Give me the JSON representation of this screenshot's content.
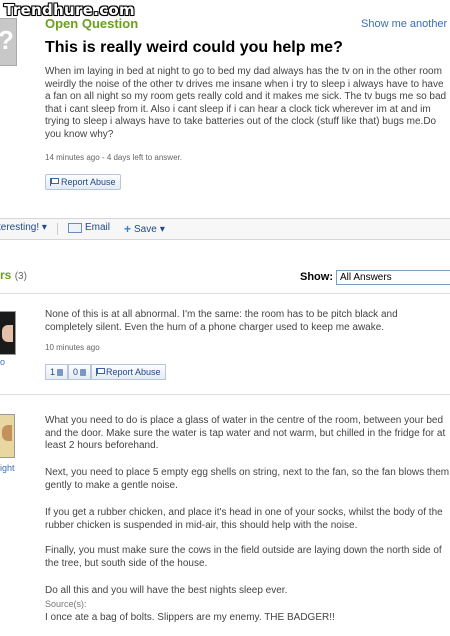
{
  "watermark": "Trendhure.com",
  "question": {
    "header": "Open Question",
    "show_another": "Show me another »",
    "title": "This is really weird could you help me?",
    "body": "When im laying in bed at night to go to bed my dad always has the tv on in the other room weirdly the noise of the other tv drives me insane when i try to sleep i always have to have a fan on all night so my room gets really cold and it makes me sick. The tv bugs me so bad that i cant sleep from it. Also i cant sleep if i can hear a clock tick wherever im at and im trying to sleep i always have to take batteries out of the clock (stuff like that) bugs me.Do you know why?",
    "meta": "14 minutes ago - 4 days left to answer.",
    "report_label": "Report Abuse"
  },
  "actions": {
    "interesting": "teresting!",
    "email": "Email",
    "save": "Save"
  },
  "answers_section": {
    "title": "rs",
    "count": "(3)",
    "show_label": "Show:",
    "show_value": "All Answers"
  },
  "answers": [
    {
      "name_fragment": "o",
      "body": "None of this is at all abnormal. I'm the same: the room has to be pitch black and completely silent. Even the hum of a phone charger used to keep me awake.",
      "meta": "10 minutes ago",
      "thumbs_up": "1",
      "thumbs_down": "0",
      "report_label": "Report Abuse"
    },
    {
      "name_fragment": "ight",
      "paragraphs": [
        "What you need to do is place a glass of water in the centre of the room, between your bed and the door. Make sure the water is tap water and not warm, but chilled in the fridge for at least 2 hours beforehand.",
        "Next, you need to place 5 empty egg shells on string, next to the fan, so the fan blows them gently to make a gentle noise.",
        "If you get a rubber chicken, and place it's head in one of your socks, whilst the body of the rubber chicken is suspended in mid-air, this should help with the noise.",
        "Finally, you must make sure the cows in the field outside are laying down the north side of the tree, but south side of the house.",
        "Do all this and you will have the best nights sleep ever."
      ],
      "source_label": "Source(s):",
      "source_text": "I once ate a bag of bolts. Slippers are my enemy. THE BADGER!!"
    }
  ]
}
